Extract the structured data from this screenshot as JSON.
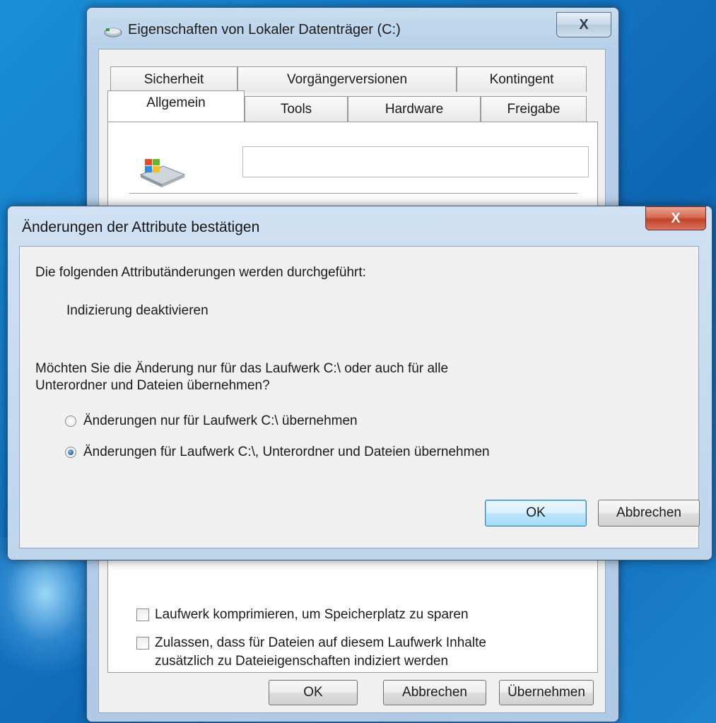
{
  "properties_window": {
    "title": "Eigenschaften von Lokaler Datenträger (C:)",
    "close_label": "X",
    "tabs_row1": [
      "Sicherheit",
      "Vorgängerversionen",
      "Kontingent"
    ],
    "tabs_row2": [
      "Allgemein",
      "Tools",
      "Hardware",
      "Freigabe"
    ],
    "active_tab": "Allgemein",
    "drive_label_value": "",
    "checkboxes": [
      {
        "label": "Laufwerk komprimieren, um Speicherplatz zu sparen",
        "checked": false
      },
      {
        "label": "Zulassen, dass für Dateien auf diesem Laufwerk Inhalte zusätzlich zu Dateieigenschaften indiziert werden",
        "checked": false
      }
    ],
    "buttons": {
      "ok": "OK",
      "cancel": "Abbrechen",
      "apply": "Übernehmen"
    }
  },
  "confirm_dialog": {
    "title": "Änderungen der Attribute bestätigen",
    "close_label": "X",
    "intro": "Die folgenden Attributänderungen werden durchgeführt:",
    "change": "Indizierung deaktivieren",
    "question_line1": "Möchten Sie die Änderung nur für das Laufwerk C:\\ oder auch für alle",
    "question_line2": "Unterordner und Dateien übernehmen?",
    "options": [
      {
        "label": "Änderungen nur für Laufwerk C:\\ übernehmen",
        "selected": false
      },
      {
        "label": "Änderungen für Laufwerk C:\\, Unterordner und Dateien übernehmen",
        "selected": true
      }
    ],
    "buttons": {
      "ok": "OK",
      "cancel": "Abbrechen"
    }
  }
}
